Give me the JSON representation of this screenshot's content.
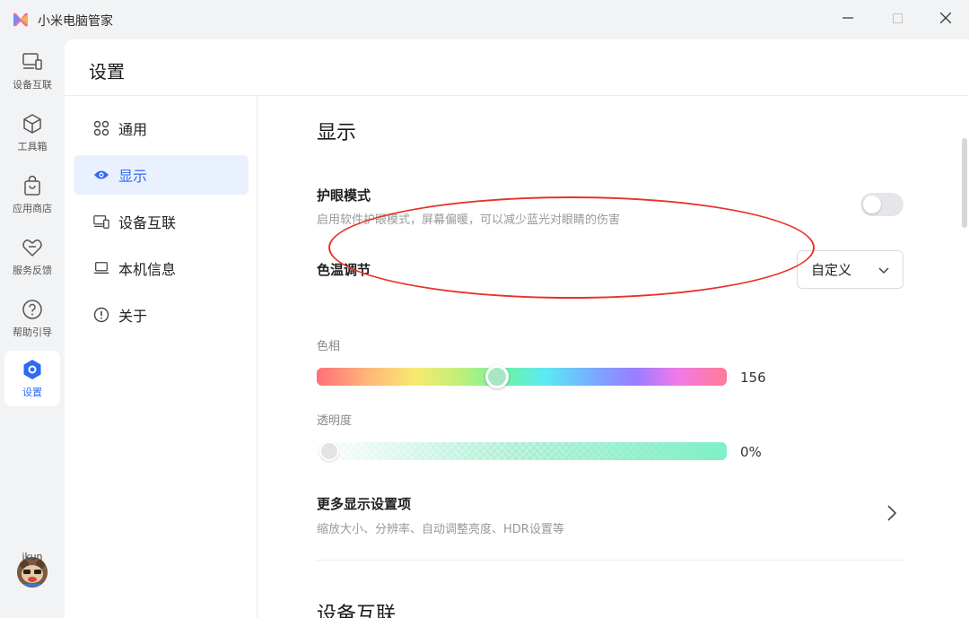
{
  "window": {
    "title": "小米电脑管家",
    "minimize_glyph": "—",
    "maximize_glyph": "☐",
    "close_glyph": "✕"
  },
  "rail": {
    "items": [
      {
        "label": "设备互联",
        "icon": "devices-icon"
      },
      {
        "label": "工具箱",
        "icon": "cube-icon"
      },
      {
        "label": "应用商店",
        "icon": "store-bag-icon"
      },
      {
        "label": "服务反馈",
        "icon": "heart-feedback-icon"
      },
      {
        "label": "帮助引导",
        "icon": "help-icon"
      },
      {
        "label": "设置",
        "icon": "settings-hex-icon",
        "active": true
      }
    ],
    "user": {
      "name": "ikun",
      "icon": "avatar"
    }
  },
  "page": {
    "title": "设置"
  },
  "subnav": {
    "items": [
      {
        "label": "通用",
        "icon": "grid-icon"
      },
      {
        "label": "显示",
        "icon": "eye-icon",
        "active": true
      },
      {
        "label": "设备互联",
        "icon": "devices-icon"
      },
      {
        "label": "本机信息",
        "icon": "laptop-icon"
      },
      {
        "label": "关于",
        "icon": "info-icon"
      }
    ]
  },
  "display": {
    "section_title": "显示",
    "eye_care": {
      "title": "护眼模式",
      "desc": "启用软件护眼模式，屏幕偏暖，可以减少蓝光对眼睛的伤害",
      "enabled": false
    },
    "color_temp": {
      "title": "色温调节",
      "mode": "自定义"
    },
    "hue": {
      "label": "色相",
      "value": "156",
      "position": 0.44
    },
    "opacity": {
      "label": "透明度",
      "value": "0%",
      "position": 0.03
    },
    "more": {
      "title": "更多显示设置项",
      "desc": "缩放大小、分辨率、自动调整亮度、HDR设置等"
    }
  },
  "device_link": {
    "section_title": "设备互联"
  },
  "colors": {
    "accent": "#2f6af5",
    "active_bg": "#eaf1fe",
    "annotation": "#e5332a"
  }
}
